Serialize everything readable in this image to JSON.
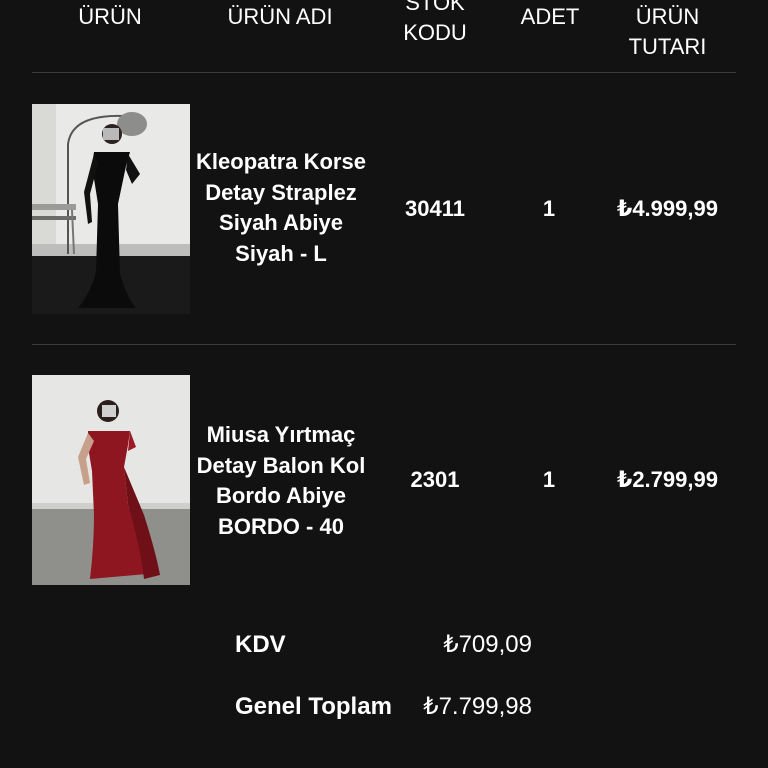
{
  "table": {
    "headers": {
      "product": "ÜRÜN",
      "product_name": "ÜRÜN ADI",
      "stock_code": "STOK\nKODU",
      "quantity": "ADET",
      "product_total": "ÜRÜN\nTUTARI"
    },
    "rows": [
      {
        "image_name": "black-strapless-evening-dress-photo",
        "name": "Kleopatra Korse Detay Straplez Siyah Abiye Siyah - L",
        "stock_code": "30411",
        "quantity": "1",
        "price": "₺4.999,99"
      },
      {
        "image_name": "burgundy-slit-evening-dress-photo",
        "name": "Miusa Yırtmaç Detay Balon Kol Bordo Abiye BORDO - 40",
        "stock_code": "2301",
        "quantity": "1",
        "price": "₺2.799,99"
      }
    ]
  },
  "summary": {
    "tax_label": "KDV",
    "tax_value": "₺709,09",
    "grand_total_label": "Genel Toplam",
    "grand_total_value": "₺7.799,98"
  },
  "colors": {
    "background": "#121212",
    "text": "#ffffff",
    "divider": "#3a3a3a",
    "dress_black": "#0b0b0b",
    "dress_burgundy": "#8e1620"
  }
}
